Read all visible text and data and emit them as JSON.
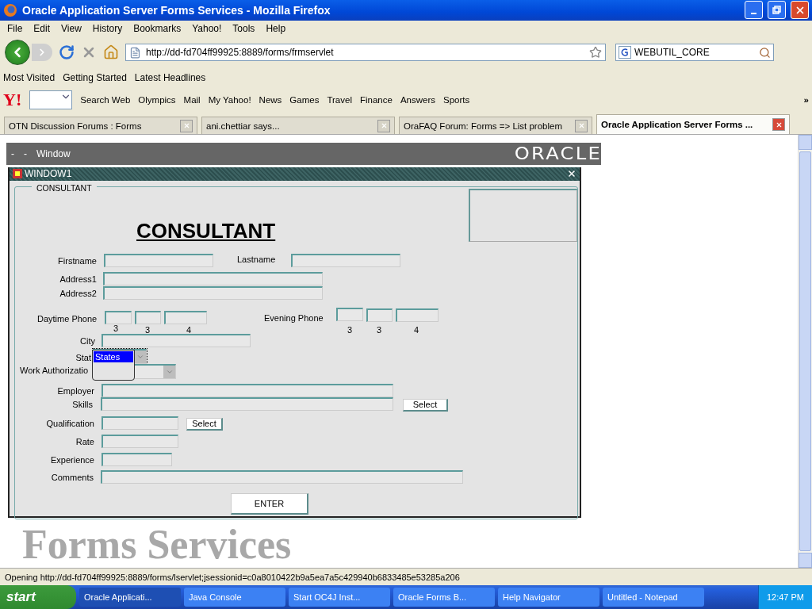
{
  "window": {
    "title": "Oracle Application Server Forms Services - Mozilla Firefox"
  },
  "menu": [
    "File",
    "Edit",
    "View",
    "History",
    "Bookmarks",
    "Yahoo!",
    "Tools",
    "Help"
  ],
  "nav": {
    "url": "http://dd-fd704ff99925:8889/forms/frmservlet",
    "search": "WEBUTIL_CORE"
  },
  "bookmarks": [
    "Most Visited",
    "Getting Started",
    "Latest Headlines"
  ],
  "yahoo_toolbar": {
    "logo": "Y!",
    "items": [
      "Search Web",
      "Olympics",
      "Mail",
      "My Yahoo!",
      "News",
      "Games",
      "Travel",
      "Finance",
      "Answers",
      "Sports"
    ],
    "more": "»"
  },
  "tabs": [
    {
      "label": "OTN Discussion Forums : Forms",
      "selected": false
    },
    {
      "label": "ani.chettiar says...",
      "selected": false
    },
    {
      "label": "OraFAQ Forum: Forms => List problem",
      "selected": false
    },
    {
      "label": "Oracle Application Server Forms ...",
      "selected": true
    }
  ],
  "forms_menu": {
    "items": [
      "-",
      "-",
      "Window"
    ],
    "logo": "ORACLE"
  },
  "form_window": {
    "title": "WINDOW1",
    "frame_title": "CONSULTANT",
    "heading": "CONSULTANT",
    "items": [
      {
        "kind": "text",
        "label": "Firstname"
      },
      {
        "kind": "text",
        "label": "Lastname"
      },
      {
        "kind": "text",
        "label": "Address1"
      },
      {
        "kind": "text",
        "label": "Address2"
      },
      {
        "kind": "phone",
        "label": "Daytime Phone",
        "parts": [
          "3",
          "3",
          "4"
        ]
      },
      {
        "kind": "phone",
        "label": "Evening Phone",
        "parts": [
          "3",
          "3",
          "4"
        ]
      },
      {
        "kind": "text",
        "label": "City"
      },
      {
        "kind": "combo",
        "label": "Stat",
        "open": true,
        "options": [
          {
            "label": "States",
            "selected": true
          }
        ]
      },
      {
        "kind": "combo",
        "label": "Work Authorizatio",
        "open": false
      },
      {
        "kind": "text",
        "label": "Employer"
      },
      {
        "kind": "text",
        "label": "Skills",
        "button": "Select"
      },
      {
        "kind": "text",
        "label": "Qualification",
        "button": "Select"
      },
      {
        "kind": "text",
        "label": "Rate"
      },
      {
        "kind": "text",
        "label": "Experience"
      },
      {
        "kind": "text",
        "label": "Comments"
      }
    ],
    "button": "ENTER"
  },
  "background_text": "Forms Services",
  "status_bar": "Opening http://dd-fd704ff99925:8889/forms/lservlet;jsessionid=c0a8010422b9a5ea7a5c429940b6833485e53285a206",
  "taskbar": {
    "start": "start",
    "items": [
      {
        "label": "Oracle Applicati...",
        "selected": true
      },
      {
        "label": "Java Console",
        "selected": false
      },
      {
        "label": "Start OC4J Inst...",
        "selected": false
      },
      {
        "label": "Oracle Forms B...",
        "selected": false
      },
      {
        "label": "Help Navigator",
        "selected": false
      },
      {
        "label": "Untitled - Notepad",
        "selected": false
      }
    ],
    "time": "12:47 PM"
  }
}
